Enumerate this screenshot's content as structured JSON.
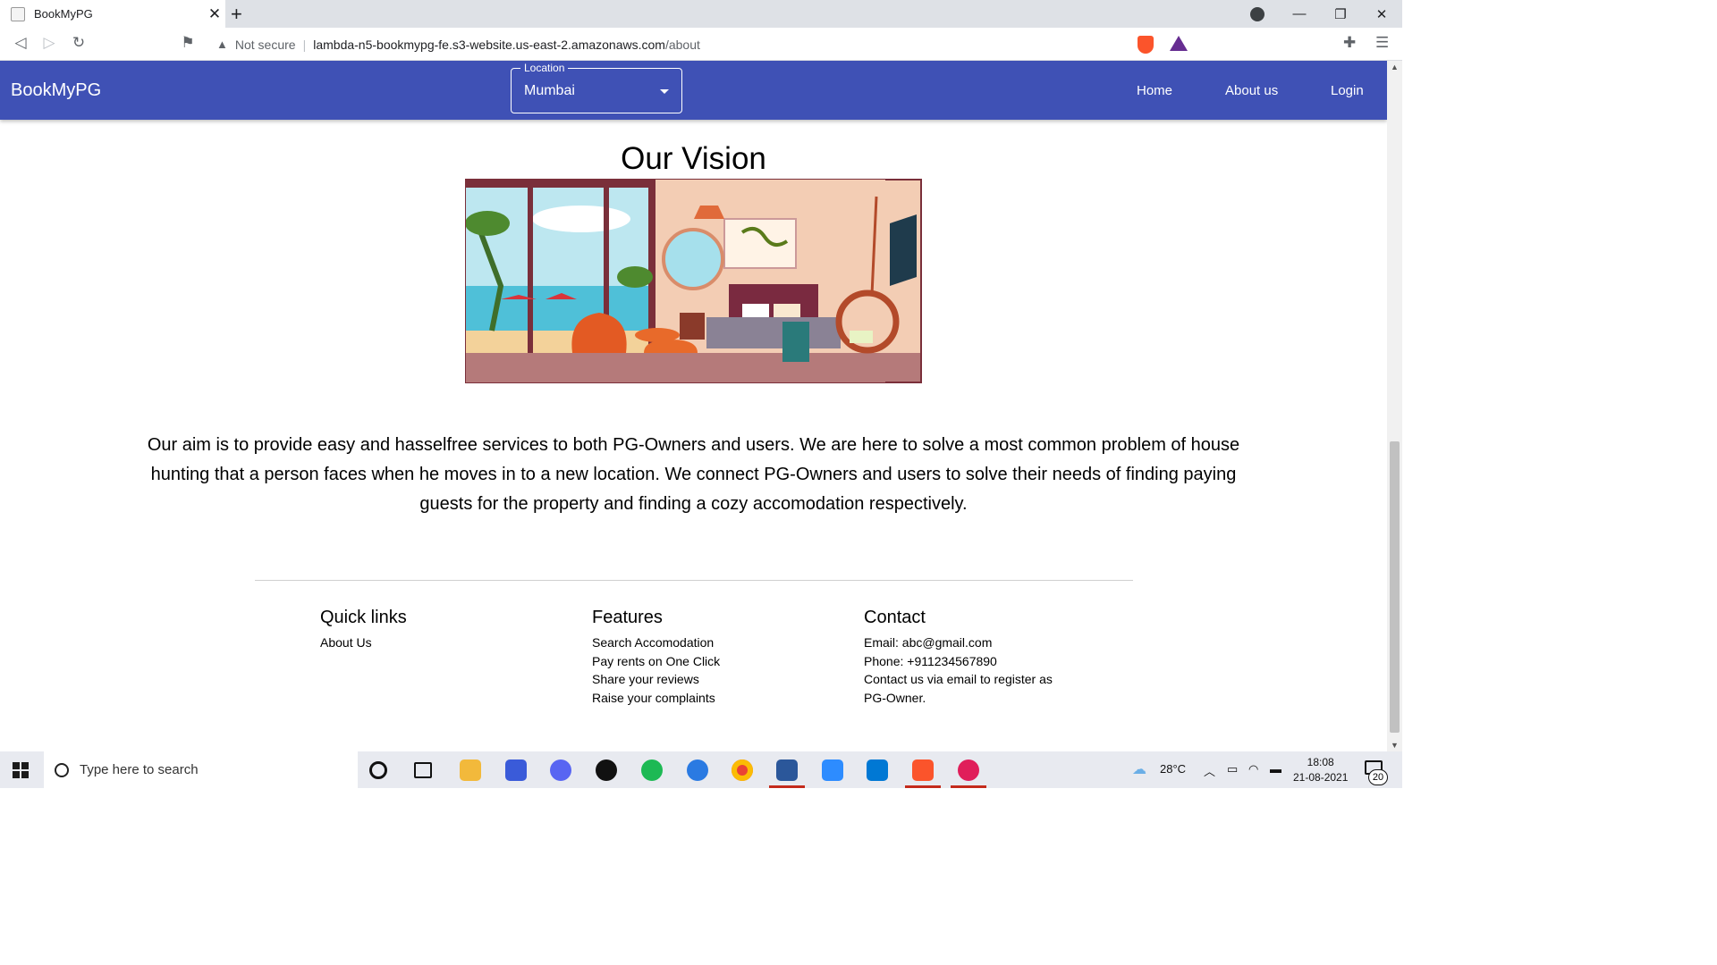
{
  "browser": {
    "tab_title": "BookMyPG",
    "new_tab": "+",
    "close_tab": "✕",
    "window_controls": {
      "minimize": "—",
      "restore": "❐",
      "close": "✕"
    },
    "security_label": "Not secure",
    "url_host": "lambda-n5-bookmypg-fe.s3-website.us-east-2.amazonaws.com",
    "url_path": "/about"
  },
  "navbar": {
    "brand": "BookMyPG",
    "location_label": "Location",
    "location_value": "Mumbai",
    "links": [
      "Home",
      "About us",
      "Login"
    ]
  },
  "vision": {
    "title": "Our Vision",
    "illustration": "bedroom-illustration",
    "text": "Our aim is to provide easy and hasselfree services to both PG-Owners and users. We are here to solve a most common problem of house hunting that a person faces when he moves in to a new location. We connect PG-Owners and users to solve their needs of finding paying guests for the property and finding a cozy accomodation respectively."
  },
  "footer": {
    "quick_links": {
      "heading": "Quick links",
      "items": [
        "About Us"
      ]
    },
    "features": {
      "heading": "Features",
      "items": [
        "Search Accomodation",
        "Pay rents on One Click",
        "Share your reviews",
        "Raise your complaints"
      ]
    },
    "contact": {
      "heading": "Contact",
      "lines": [
        "Email: abc@gmail.com",
        "Phone: +911234567890",
        "Contact us via email to register as",
        "PG-Owner."
      ]
    }
  },
  "taskbar": {
    "search_placeholder": "Type here to search",
    "temperature": "28°C",
    "time": "18:08",
    "date": "21-08-2021",
    "notifications": "20"
  },
  "colors": {
    "appbar": "#3f51b5",
    "brave": "#fb542b"
  }
}
